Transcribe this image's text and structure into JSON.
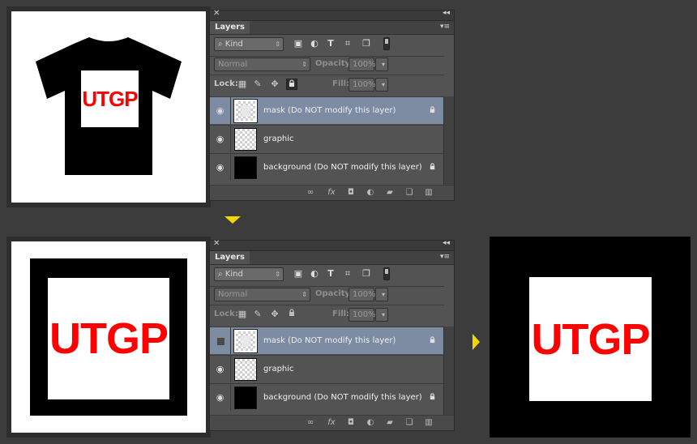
{
  "top_canvas": {
    "logo_text": "UTGP"
  },
  "bottom_canvas": {
    "logo_text": "UTGP"
  },
  "result_canvas": {
    "logo_text": "UTGP"
  },
  "panels": [
    {
      "tab": "Layers",
      "filter_kind": "Kind",
      "blend_mode": "Normal",
      "opacity_label": "Opacity:",
      "opacity_value": "100%",
      "lock_label": "Lock:",
      "fill_label": "Fill:",
      "fill_value": "100%",
      "layers": [
        {
          "name": "mask (Do NOT modify this layer)",
          "visible": true
        },
        {
          "name": "graphic",
          "visible": true
        },
        {
          "name": "background (Do NOT modify this layer)",
          "visible": true
        }
      ]
    },
    {
      "tab": "Layers",
      "filter_kind": "Kind",
      "blend_mode": "Normal",
      "opacity_label": "Opacity:",
      "opacity_value": "100%",
      "lock_label": "Lock:",
      "fill_label": "Fill:",
      "fill_value": "100%",
      "layers": [
        {
          "name": "mask (Do NOT modify this layer)",
          "visible": false
        },
        {
          "name": "graphic",
          "visible": true
        },
        {
          "name": "background (Do NOT modify this layer)",
          "visible": true
        }
      ]
    }
  ],
  "colors": {
    "logo": "#ff0000",
    "arrow": "#f0d800",
    "selected_layer": "#7d8ca3"
  },
  "icons": {
    "layer_visibility": "eye-icon",
    "layer_lock": "padlock-icon",
    "arrow_down": "down-arrow-icon",
    "arrow_right": "right-arrow-icon"
  }
}
